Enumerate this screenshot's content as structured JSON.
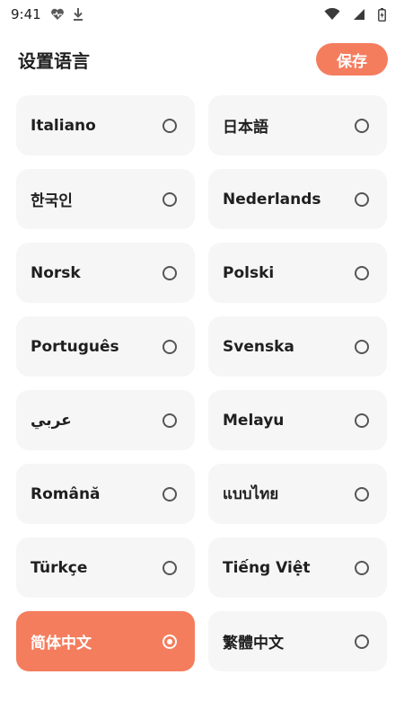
{
  "status_bar": {
    "time": "9:41",
    "icons": [
      "heart-pulse-icon",
      "download-icon",
      "wifi-icon",
      "cell-signal-icon",
      "battery-icon"
    ]
  },
  "header": {
    "title": "设置语言",
    "save_label": "保存"
  },
  "colors": {
    "accent": "#f47d5e",
    "card_bg": "#f6f6f6",
    "text": "#1f1f1f"
  },
  "languages": [
    {
      "label": "",
      "selected": false
    },
    {
      "label": "",
      "selected": false
    },
    {
      "label": "Italiano",
      "selected": false
    },
    {
      "label": "日本語",
      "selected": false
    },
    {
      "label": "한국인",
      "selected": false
    },
    {
      "label": "Nederlands",
      "selected": false
    },
    {
      "label": "Norsk",
      "selected": false
    },
    {
      "label": "Polski",
      "selected": false
    },
    {
      "label": "Português",
      "selected": false
    },
    {
      "label": "Svenska",
      "selected": false
    },
    {
      "label": "عربي",
      "selected": false
    },
    {
      "label": "Melayu",
      "selected": false
    },
    {
      "label": "Română",
      "selected": false
    },
    {
      "label": "แบบไทย",
      "selected": false
    },
    {
      "label": "Türkçe",
      "selected": false
    },
    {
      "label": "Tiếng Việt",
      "selected": false
    },
    {
      "label": "简体中文",
      "selected": true
    },
    {
      "label": "繁體中文",
      "selected": false
    }
  ]
}
